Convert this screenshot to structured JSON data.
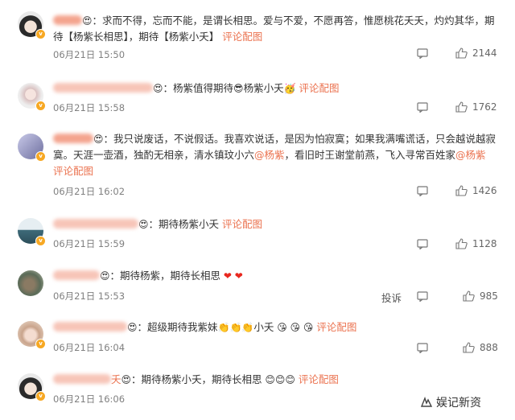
{
  "comments": [
    {
      "name_suffix": "",
      "content": "求而不得，忘而不能，是谓长相思。爱与不爱，不愿再答，惟愿桃花夭夭，灼灼其华，期待【杨紫长相思】，期待【杨紫小夭】",
      "link": "评论配图",
      "time": "06月21日 15:50",
      "likes": "2144"
    },
    {
      "name_suffix": "",
      "content_a": "杨紫值得期待",
      "content_b": "杨紫小夭",
      "link": "评论配图",
      "time": "06月21日 15:58",
      "likes": "1762"
    },
    {
      "content_a": "我只说废话，不说假话。我喜欢说话，是因为怕寂寞；如果我满嘴谎话，只会越说越寂寞。天涯一壶酒，独酌无相亲，清水镇玟小六",
      "mention1": "@杨紫",
      "content_b": "，看旧时王谢堂前燕，飞入寻常百姓家",
      "mention2": "@杨紫",
      "link": "评论配图",
      "time": "06月21日 16:02",
      "likes": "1426"
    },
    {
      "content": "期待杨紫小夭",
      "link": "评论配图",
      "time": "06月21日 15:59",
      "likes": "1128"
    },
    {
      "content": "期待杨紫，期待长相思",
      "time": "06月21日 15:53",
      "likes": "985",
      "report": "投诉"
    },
    {
      "content_a": "超级期待我紫妹",
      "content_b": "小夭",
      "link": "评论配图",
      "time": "06月21日 16:04",
      "likes": "888"
    },
    {
      "name_suffix": "夭",
      "content": "期待杨紫小夭，期待长相思",
      "link": "评论配图",
      "time": "06月21日 16:06"
    }
  ],
  "watermark": "娱记新资",
  "colors": {
    "accent": "#eb7350",
    "meta": "#808080",
    "badge": "#f7a823"
  },
  "icons": {
    "reply": "comment-icon",
    "like": "thumb-up-icon",
    "report": "report-text"
  }
}
